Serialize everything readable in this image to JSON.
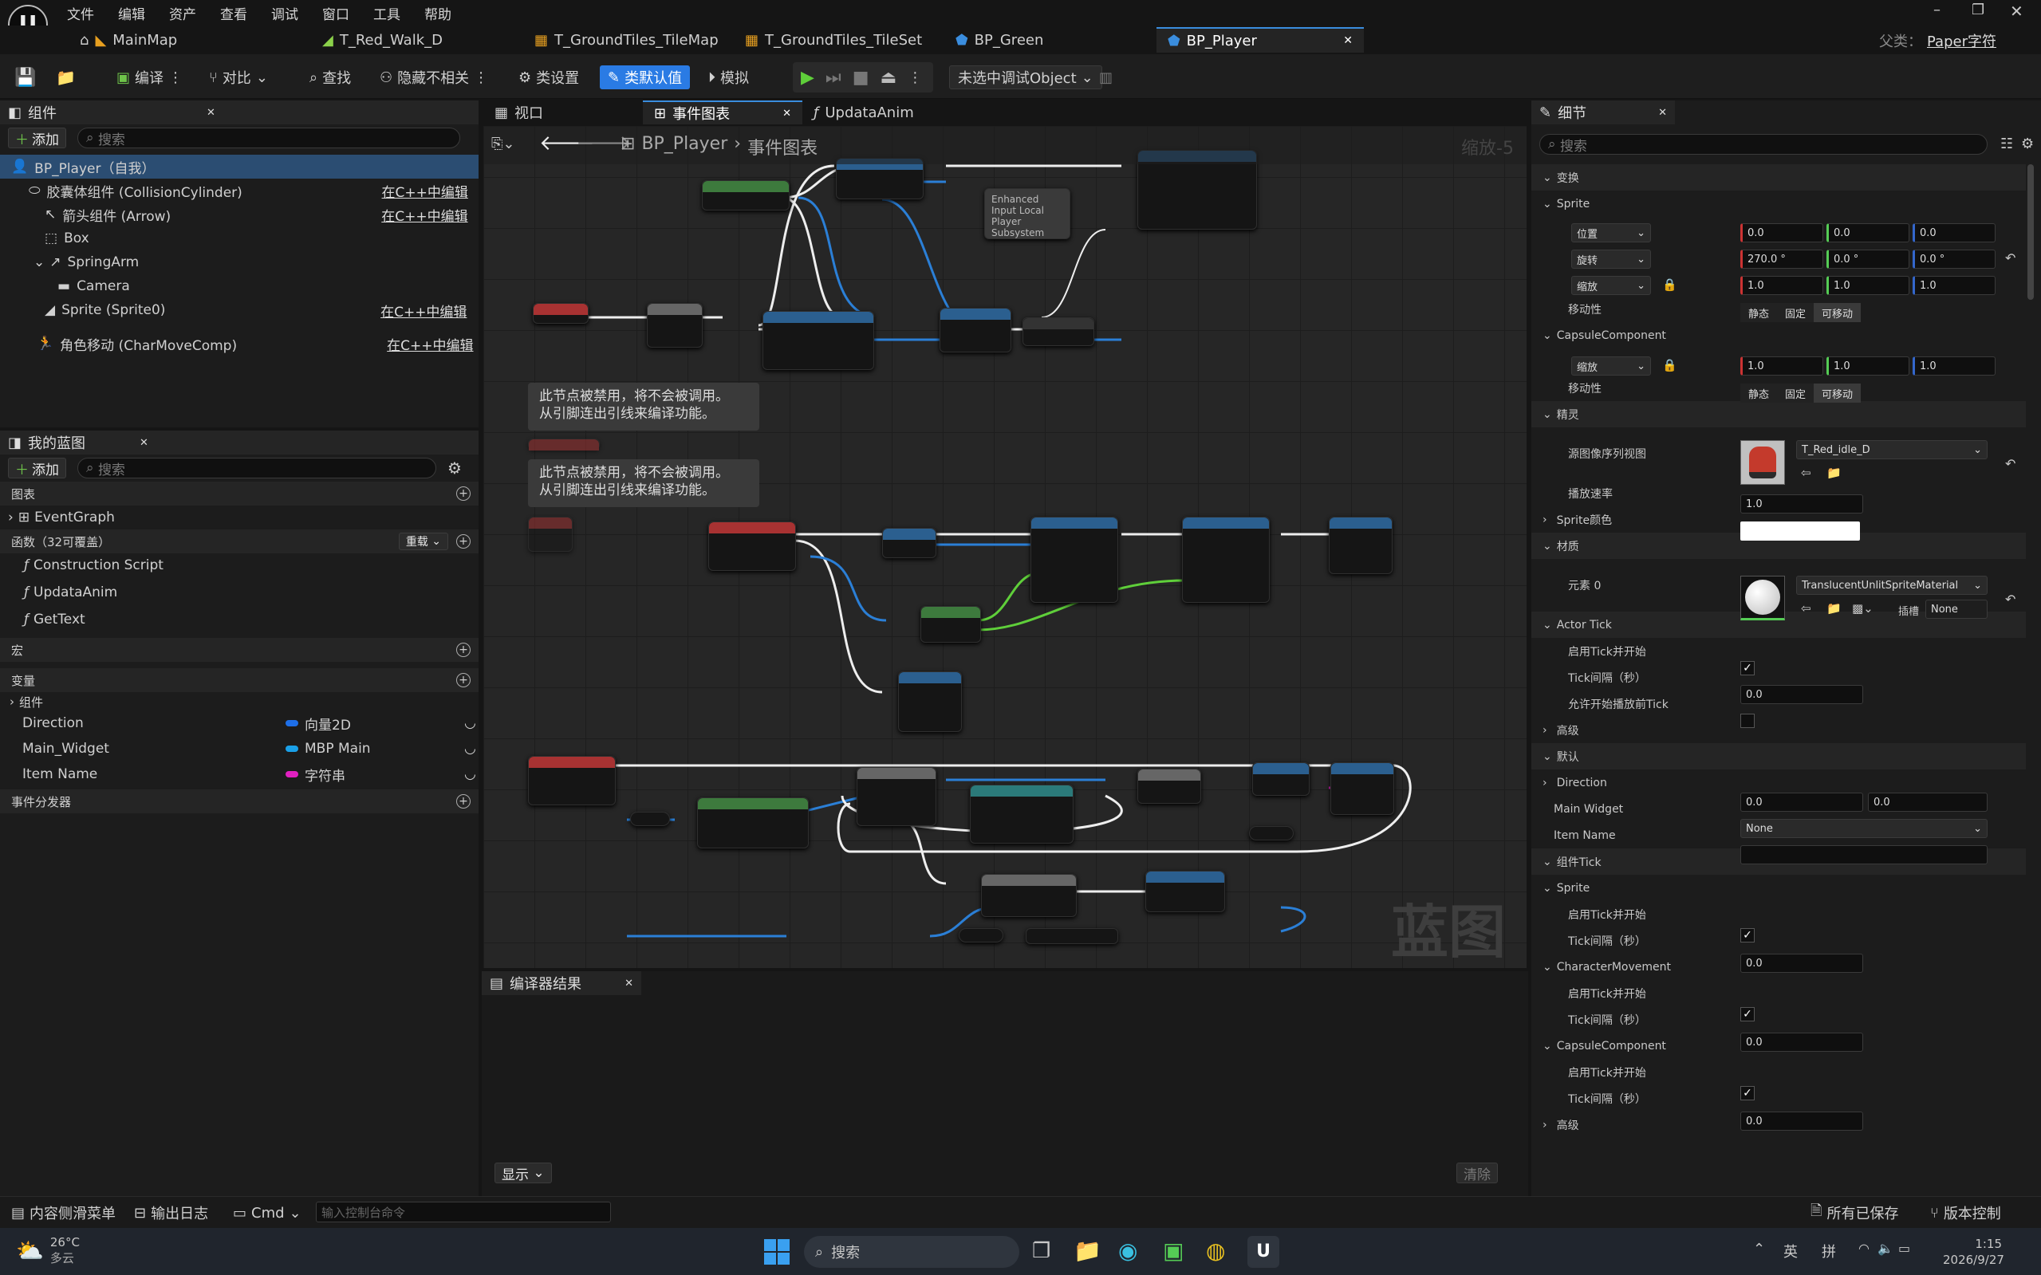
{
  "menu": [
    "文件",
    "编辑",
    "资产",
    "查看",
    "调试",
    "窗口",
    "工具",
    "帮助"
  ],
  "doc_tabs": {
    "home": "MainMap",
    "t1": "T_Red_Walk_D",
    "t2": "T_GroundTiles_TileMap",
    "t3": "T_GroundTiles_TileSet",
    "t4": "BP_Green",
    "t5": "BP_Player"
  },
  "parent": {
    "label": "父类：",
    "value": "Paper字符"
  },
  "toolbar": {
    "compile": "编译",
    "diff": "对比",
    "find": "查找",
    "hide": "隐藏不相关",
    "class_settings": "类设置",
    "class_defaults": "类默认值",
    "simulate": "模拟",
    "debug_object": "未选中调试Object"
  },
  "components": {
    "title": "组件",
    "add": "添加",
    "search": "搜索",
    "items": [
      {
        "label": "BP_Player（自我）",
        "edit": ""
      },
      {
        "label": "胶囊体组件 (CollisionCylinder)",
        "edit": "在C++中编辑"
      },
      {
        "label": "箭头组件 (Arrow)",
        "edit": "在C++中编辑"
      },
      {
        "label": "Box",
        "edit": ""
      },
      {
        "label": "SpringArm",
        "edit": ""
      },
      {
        "label": "Camera",
        "edit": ""
      },
      {
        "label": "Sprite (Sprite0)",
        "edit": "在C++中编辑"
      },
      {
        "label": "角色移动 (CharMoveComp)",
        "edit": "在C++中编辑"
      }
    ]
  },
  "myblueprint": {
    "title": "我的蓝图",
    "add": "添加",
    "search": "搜索",
    "graphs": "图表",
    "eventgraph": "EventGraph",
    "functions": "函数（32可覆盖）",
    "override": "重载",
    "func_items": [
      "Construction Script",
      "UpdataAnim",
      "GetText"
    ],
    "macros": "宏",
    "variables": "变量",
    "components": "组件",
    "vars": [
      {
        "name": "Direction",
        "type": "向量2D",
        "color": "#1e6fe8"
      },
      {
        "name": "Main_Widget",
        "type": "MBP Main",
        "color": "#1aa0e8"
      },
      {
        "name": "Item Name",
        "type": "字符串",
        "color": "#e020c0"
      }
    ],
    "dispatchers": "事件分发器"
  },
  "graph_tabs": {
    "viewport": "视口",
    "eventgraph": "事件图表",
    "updataanim": "UpdataAnim"
  },
  "breadcrumb": {
    "bp": "BP_Player",
    "graph": "事件图表",
    "zoom": "缩放-5"
  },
  "comments": [
    "此节点被禁用，将不会被调用。\n从引脚连出引线来编译功能。",
    "此节点被禁用，将不会被调用。\n从引脚连出引线来编译功能。"
  ],
  "node_subsystem": "Enhanced\nInput Local\nPlayer\nSubsystem",
  "watermark": "蓝图",
  "compiler": {
    "title": "编译器结果",
    "show": "显示",
    "clear": "清除"
  },
  "details": {
    "title": "细节",
    "search": "搜索",
    "transform": "变换",
    "sprite": "Sprite",
    "location": "位置",
    "rotation": "旋转",
    "scale": "缩放",
    "mobility": "移动性",
    "loc": [
      "0.0",
      "0.0",
      "0.0"
    ],
    "rot": [
      "270.0 °",
      "0.0 °",
      "0.0 °"
    ],
    "scl": [
      "1.0",
      "1.0",
      "1.0"
    ],
    "mob": [
      "静态",
      "固定",
      "可移动"
    ],
    "capsule": "CapsuleComponent",
    "capscale": [
      "1.0",
      "1.0",
      "1.0"
    ],
    "sprite_sec": "精灵",
    "source_flipbook": "源图像序列视图",
    "flipbook": "T_Red_idle_D",
    "play_rate_label": "播放速率",
    "play_rate": "1.0",
    "sprite_color": "Sprite颜色",
    "materials": "材质",
    "element0": "元素 0",
    "material": "TranslucentUnlitSpriteMaterial",
    "slot": "插槽",
    "slot_value": "None",
    "actor_tick": "Actor Tick",
    "start_tick": "启用Tick并开始",
    "tick_interval": "Tick间隔（秒）",
    "tick_value": "0.0",
    "allow_tick": "允许开始播放前Tick",
    "advanced": "高级",
    "default": "默认",
    "direction": "Direction",
    "dir": [
      "0.0",
      "0.0"
    ],
    "main_widget": "Main Widget",
    "mw_value": "None",
    "item_name": "Item Name",
    "component_tick": "组件Tick",
    "char_move": "CharacterMovement"
  },
  "bottom": {
    "drawer": "内容侧滑菜单",
    "output": "输出日志",
    "cmd": "Cmd",
    "console": "输入控制台命令",
    "saved": "所有已保存",
    "vc": "版本控制"
  },
  "taskbar": {
    "temp": "26°C",
    "weather": "多云",
    "search": "搜索",
    "ime1": "英",
    "ime2": "拼",
    "time": "1:15",
    "date": "2026/9/27"
  }
}
